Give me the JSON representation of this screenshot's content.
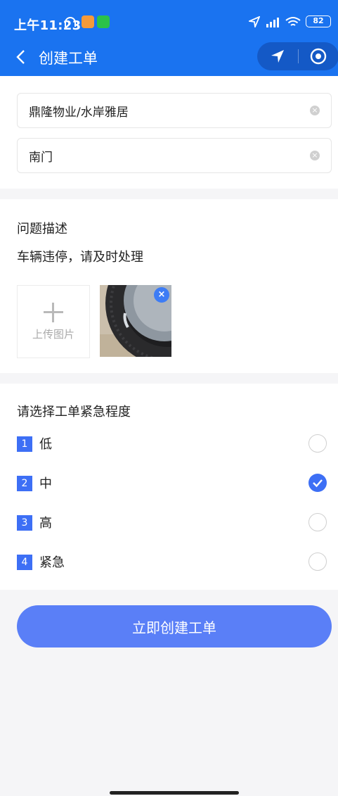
{
  "status_bar": {
    "time": "上午11:23",
    "battery": "82"
  },
  "nav": {
    "title": "创建工单"
  },
  "location": {
    "community": "鼎隆物业/水岸雅居",
    "gate": "南门"
  },
  "problem": {
    "title": "问题描述",
    "description": "车辆违停，请及时处理",
    "upload_label": "上传图片"
  },
  "urgency": {
    "title": "请选择工单紧急程度",
    "options": [
      {
        "num": "1",
        "label": "低",
        "selected": false
      },
      {
        "num": "2",
        "label": "中",
        "selected": true
      },
      {
        "num": "3",
        "label": "高",
        "selected": false
      },
      {
        "num": "4",
        "label": "紧急",
        "selected": false
      }
    ]
  },
  "submit": {
    "label": "立即创建工单"
  },
  "colors": {
    "primary": "#1a73f0",
    "accent": "#3d6ff5",
    "button": "#5a7ff7"
  }
}
